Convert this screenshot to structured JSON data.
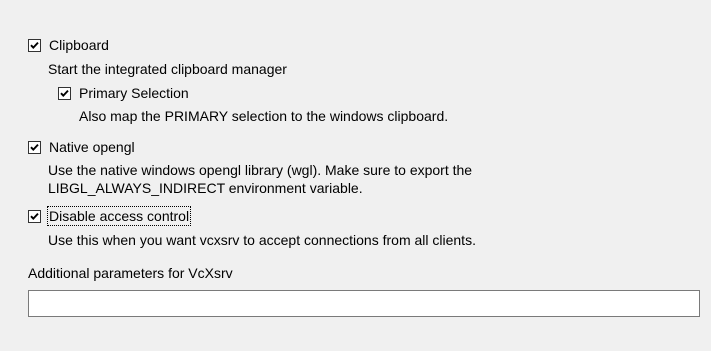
{
  "options": {
    "clipboard": {
      "label": "Clipboard",
      "checked": true,
      "description": "Start the integrated clipboard manager"
    },
    "primary_selection": {
      "label": "Primary Selection",
      "checked": true,
      "description": "Also map the PRIMARY selection to the windows clipboard."
    },
    "native_opengl": {
      "label": "Native opengl",
      "checked": true,
      "description_line1": "Use the native windows opengl library (wgl). Make sure to export the",
      "description_line2": "LIBGL_ALWAYS_INDIRECT environment variable."
    },
    "disable_access_control": {
      "label": "Disable access control",
      "checked": true,
      "focused": true,
      "description": "Use this when you want vcxsrv to accept connections from all clients."
    }
  },
  "additional_params": {
    "label": "Additional parameters for VcXsrv",
    "value": "",
    "placeholder": ""
  },
  "colors": {
    "background": "#f0f0f0",
    "input_border": "#7a7a7a",
    "checkbox_border": "#333333"
  },
  "icons": {
    "checkbox_checked": "checkmark-icon"
  }
}
